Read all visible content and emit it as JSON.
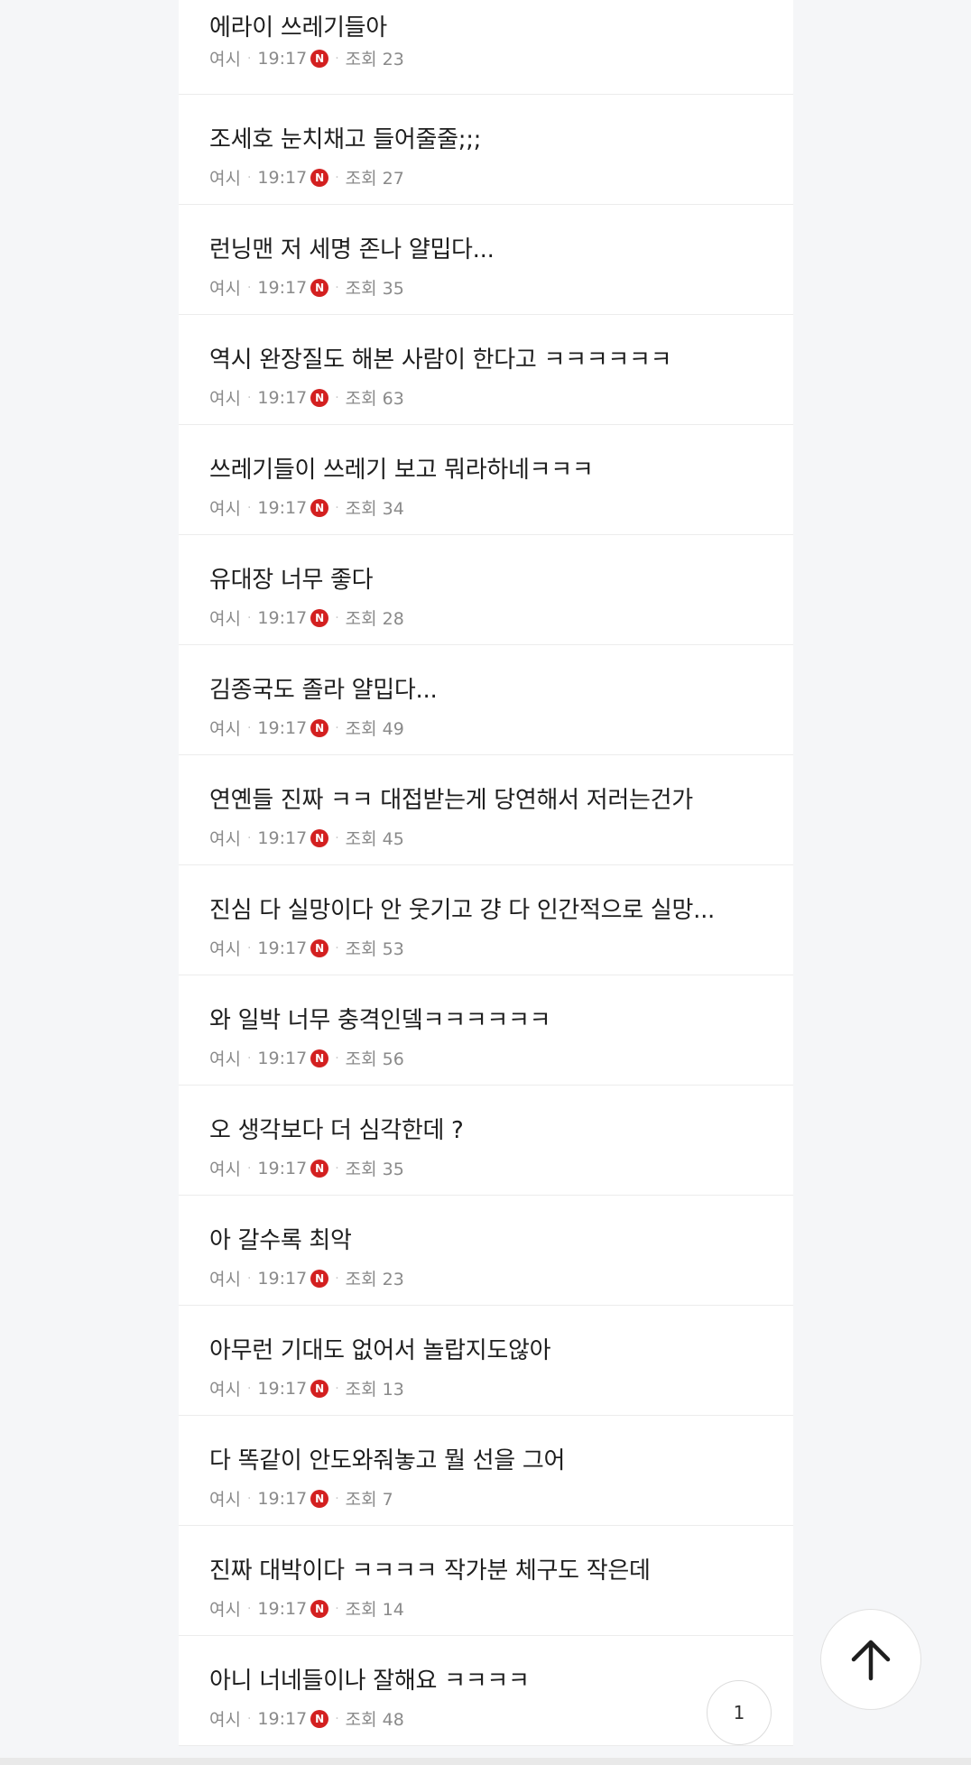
{
  "posts": [
    {
      "title": "에라이 쓰레기들아",
      "author": "여시",
      "time": "19:17",
      "badge": "N",
      "views": "조회 23"
    },
    {
      "title": "조세호 눈치채고 들어줄줄;;;",
      "author": "여시",
      "time": "19:17",
      "badge": "N",
      "views": "조회 27"
    },
    {
      "title": "런닝맨 저 세명 존나 얄밉다...",
      "author": "여시",
      "time": "19:17",
      "badge": "N",
      "views": "조회 35"
    },
    {
      "title": "역시 완장질도 해본 사람이 한다고 ㅋㅋㅋㅋㅋㅋ",
      "author": "여시",
      "time": "19:17",
      "badge": "N",
      "views": "조회 63"
    },
    {
      "title": "쓰레기들이 쓰레기 보고 뭐라하네ㅋㅋㅋ",
      "author": "여시",
      "time": "19:17",
      "badge": "N",
      "views": "조회 34"
    },
    {
      "title": "유대장 너무 좋다",
      "author": "여시",
      "time": "19:17",
      "badge": "N",
      "views": "조회 28"
    },
    {
      "title": "김종국도 졸라 얄밉다...",
      "author": "여시",
      "time": "19:17",
      "badge": "N",
      "views": "조회 49"
    },
    {
      "title": "연옌들 진짜 ㅋㅋ 대접받는게 당연해서 저러는건가",
      "author": "여시",
      "time": "19:17",
      "badge": "N",
      "views": "조회 45"
    },
    {
      "title": "진심 다 실망이다 안 웃기고 걍 다 인간적으로 실망...",
      "author": "여시",
      "time": "19:17",
      "badge": "N",
      "views": "조회 53"
    },
    {
      "title": "와 일박 너무 충격인뎈ㅋㅋㅋㅋㅋㅋ",
      "author": "여시",
      "time": "19:17",
      "badge": "N",
      "views": "조회 56"
    },
    {
      "title": "오 생각보다 더 심각한데 ?",
      "author": "여시",
      "time": "19:17",
      "badge": "N",
      "views": "조회 35"
    },
    {
      "title": "아 갈수록 최악",
      "author": "여시",
      "time": "19:17",
      "badge": "N",
      "views": "조회 23"
    },
    {
      "title": "아무런 기대도 없어서 놀랍지도않아",
      "author": "여시",
      "time": "19:17",
      "badge": "N",
      "views": "조회 13"
    },
    {
      "title": "다 똑같이 안도와줘놓고 뭘 선을 그어",
      "author": "여시",
      "time": "19:17",
      "badge": "N",
      "views": "조회 7"
    },
    {
      "title": "진짜 대박이다 ㅋㅋㅋㅋ 작가분 체구도 작은데",
      "author": "여시",
      "time": "19:17",
      "badge": "N",
      "views": "조회 14"
    },
    {
      "title": "아니 너네들이나 잘해요 ㅋㅋㅋㅋ",
      "author": "여시",
      "time": "19:17",
      "badge": "N",
      "views": "조회 48"
    }
  ],
  "pager": {
    "current_page": "1"
  },
  "top_button": {
    "icon": "arrow-up-icon"
  },
  "colors": {
    "badge": "#d32020",
    "background": "#f5f6f8",
    "card": "#ffffff"
  }
}
